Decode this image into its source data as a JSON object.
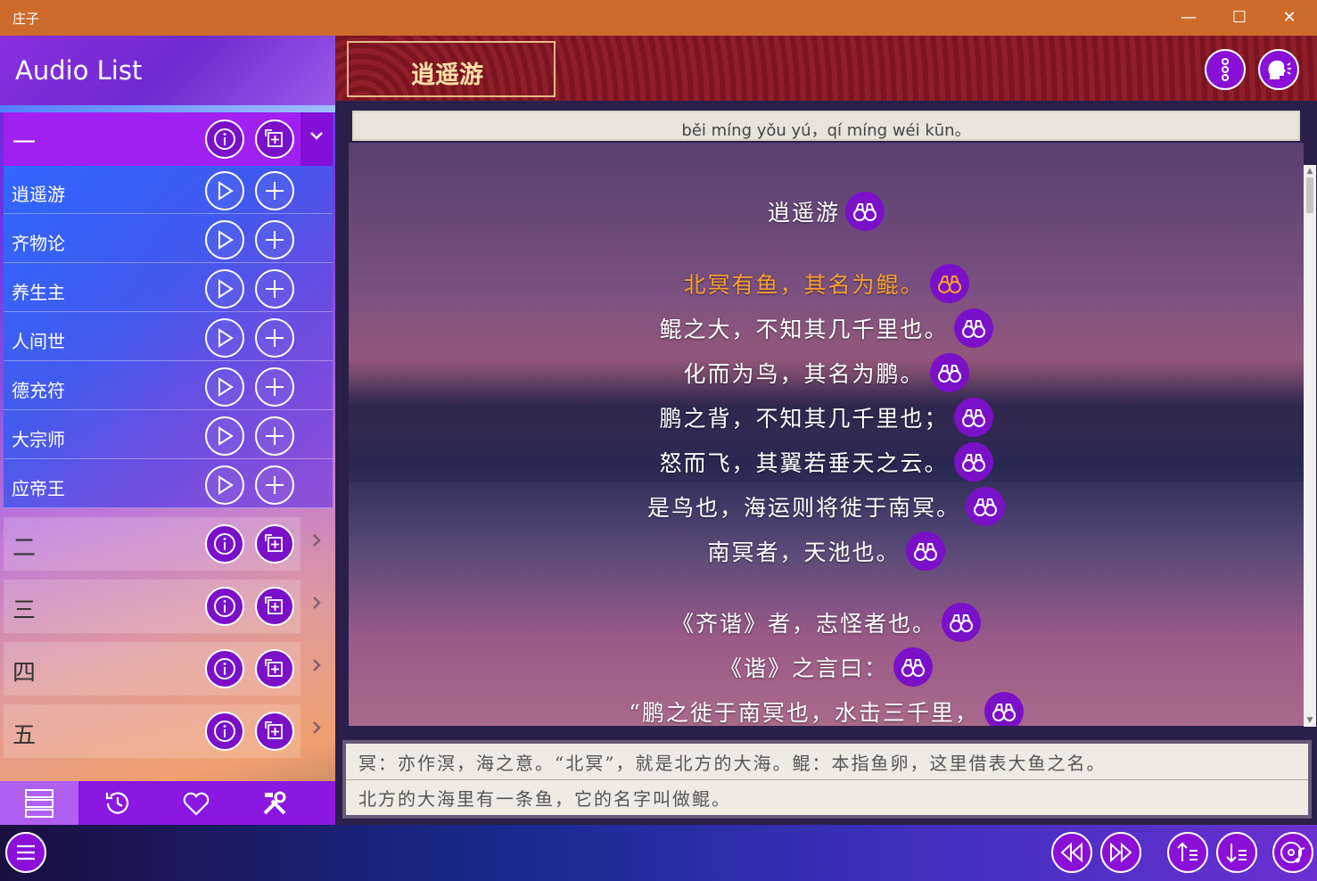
{
  "window": {
    "title": "庄子",
    "minimize": "—",
    "maximize": "☐",
    "close": "✕"
  },
  "sidebar": {
    "title": "Audio List",
    "groups": [
      {
        "label": "一",
        "expanded": true
      },
      {
        "label": "二",
        "expanded": false
      },
      {
        "label": "三",
        "expanded": false
      },
      {
        "label": "四",
        "expanded": false
      },
      {
        "label": "五",
        "expanded": false
      }
    ],
    "items": [
      "逍遥游",
      "齐物论",
      "养生主",
      "人间世",
      "德充符",
      "大宗师",
      "应帝王"
    ]
  },
  "chapter": {
    "title": "逍遥游"
  },
  "pinyin": "běi míng yǒu yú，qí míng wéi kūn。",
  "lines": [
    {
      "text": "逍遥游",
      "highlight": false
    },
    {
      "text": "北冥有鱼，其名为鲲。",
      "highlight": true
    },
    {
      "text": "鲲之大，不知其几千里也。",
      "highlight": false
    },
    {
      "text": "化而为鸟，其名为鹏。",
      "highlight": false
    },
    {
      "text": "鹏之背，不知其几千里也；",
      "highlight": false
    },
    {
      "text": "怒而飞，其翼若垂天之云。",
      "highlight": false
    },
    {
      "text": "是鸟也，海运则将徙于南冥。",
      "highlight": false
    },
    {
      "text": "南冥者，天池也。",
      "highlight": false
    },
    {
      "text": "《齐谐》者，志怪者也。",
      "highlight": false
    },
    {
      "text": "《谐》之言曰：",
      "highlight": false
    },
    {
      "text": "“鹏之徙于南冥也，水击三千里，",
      "highlight": false
    }
  ],
  "notes": {
    "annotation": "冥：亦作溟，海之意。“北冥”，就是北方的大海。鲲：本指鱼卵，这里借表大鱼之名。",
    "translation": "北方的大海里有一条鱼，它的名字叫做鲲。"
  },
  "colors": {
    "accent": "#8a10d8",
    "highlight": "#f5a030",
    "titlebar": "#cd6b2c"
  }
}
